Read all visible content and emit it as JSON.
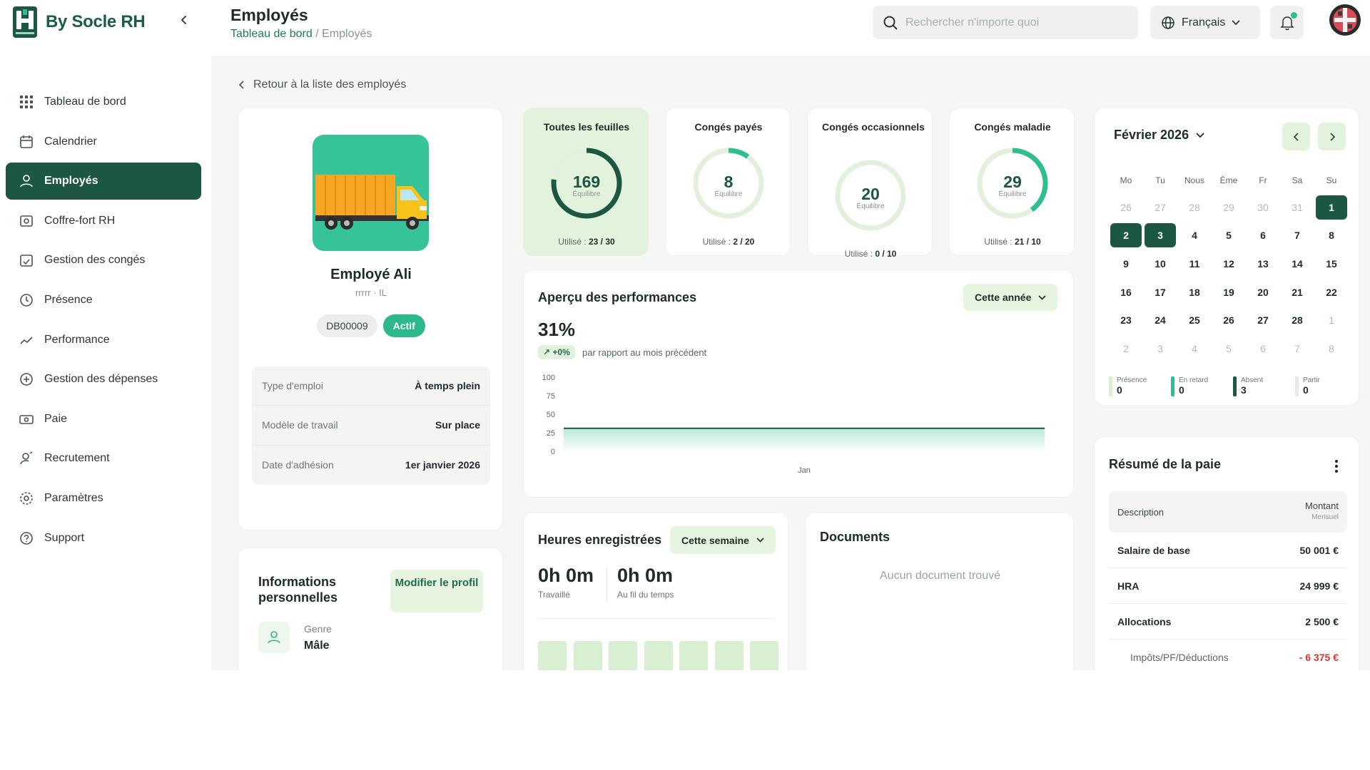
{
  "brand": {
    "name": "By Socle RH"
  },
  "sidebar": {
    "items": [
      {
        "label": "Tableau de bord"
      },
      {
        "label": "Calendrier"
      },
      {
        "label": "Employés"
      },
      {
        "label": "Coffre-fort RH"
      },
      {
        "label": "Gestion des congés"
      },
      {
        "label": "Présence"
      },
      {
        "label": "Performance"
      },
      {
        "label": "Gestion des dépenses"
      },
      {
        "label": "Paie"
      },
      {
        "label": "Recrutement"
      },
      {
        "label": "Paramètres"
      },
      {
        "label": "Support"
      }
    ],
    "active_index": 2
  },
  "header": {
    "title": "Employés",
    "breadcrumb_link": "Tableau de bord",
    "breadcrumb_separator": "/",
    "breadcrumb_current": "Employés",
    "search_placeholder": "Rechercher n'importe quoi",
    "language": "Français"
  },
  "back_link": "Retour à la liste des employés",
  "profile": {
    "name": "Employé Ali",
    "subtitle": "rrrrr · IL",
    "employee_id": "DB00009",
    "status": "Actif",
    "details": [
      {
        "label": "Type d'emploi",
        "value": "À temps plein"
      },
      {
        "label": "Modèle de travail",
        "value": "Sur place"
      },
      {
        "label": "Date d'adhésion",
        "value": "1er janvier 2026"
      }
    ]
  },
  "personal": {
    "title": "Informations personnelles",
    "edit_button": "Modifier le profil",
    "gender_label": "Genre",
    "gender_value": "Mâle"
  },
  "leave_cards": [
    {
      "title": "Toutes les feuilles",
      "value": "169",
      "sub": "Équilibre",
      "used_prefix": "Utilisé :",
      "used": "23 / 30",
      "fraction": 0.767
    },
    {
      "title": "Congés payés",
      "value": "8",
      "sub": "Équilibre",
      "used_prefix": "Utilisé :",
      "used": "2 / 20",
      "fraction": 0.1
    },
    {
      "title": "Congés occasionnels",
      "value": "20",
      "sub": "Équilibre",
      "used_prefix": "Utilisé :",
      "used": "0 / 10",
      "fraction": 0.0
    },
    {
      "title": "Congés maladie",
      "value": "29",
      "sub": "Équilibre",
      "used_prefix": "Utilisé :",
      "used": "21 / 10",
      "fraction": 0.4
    }
  ],
  "performance": {
    "title": "Aperçu des performances",
    "period": "Cette année",
    "percent": "31%",
    "change": "+0%",
    "comparison": "par rapport au mois précédent"
  },
  "chart_data": {
    "type": "area",
    "categories": [
      "Jan"
    ],
    "series": [
      {
        "values": [
          31
        ]
      }
    ],
    "yticks": [
      "100",
      "75",
      "50",
      "25",
      "0"
    ],
    "ylim": [
      0,
      100
    ],
    "grid": false
  },
  "hours": {
    "title": "Heures enregistrées",
    "period": "Cette semaine",
    "worked_value": "0h 0m",
    "worked_label": "Travaillé",
    "overtime_value": "0h 0m",
    "overtime_label": "Au fil du temps"
  },
  "documents": {
    "title": "Documents",
    "empty": "Aucun document trouvé"
  },
  "calendar": {
    "month": "Février 2026",
    "weekdays": [
      "Mo",
      "Tu",
      "Nous",
      "Ème",
      "Fr",
      "Sa",
      "Su"
    ],
    "days": [
      {
        "d": "26",
        "m": true
      },
      {
        "d": "27",
        "m": true
      },
      {
        "d": "28",
        "m": true
      },
      {
        "d": "29",
        "m": true
      },
      {
        "d": "30",
        "m": true
      },
      {
        "d": "31",
        "m": true
      },
      {
        "d": "1",
        "s": true
      },
      {
        "d": "2",
        "s": true
      },
      {
        "d": "3",
        "s": true
      },
      {
        "d": "4"
      },
      {
        "d": "5"
      },
      {
        "d": "6"
      },
      {
        "d": "7"
      },
      {
        "d": "8"
      },
      {
        "d": "9"
      },
      {
        "d": "10"
      },
      {
        "d": "11"
      },
      {
        "d": "12"
      },
      {
        "d": "13"
      },
      {
        "d": "14"
      },
      {
        "d": "15"
      },
      {
        "d": "16"
      },
      {
        "d": "17"
      },
      {
        "d": "18"
      },
      {
        "d": "19"
      },
      {
        "d": "20"
      },
      {
        "d": "21"
      },
      {
        "d": "22"
      },
      {
        "d": "23"
      },
      {
        "d": "24"
      },
      {
        "d": "25"
      },
      {
        "d": "26"
      },
      {
        "d": "27"
      },
      {
        "d": "28"
      },
      {
        "d": "1",
        "m": true
      },
      {
        "d": "2",
        "m": true
      },
      {
        "d": "3",
        "m": true
      },
      {
        "d": "4",
        "m": true
      },
      {
        "d": "5",
        "m": true
      },
      {
        "d": "6",
        "m": true
      },
      {
        "d": "7",
        "m": true
      },
      {
        "d": "8",
        "m": true
      }
    ],
    "legend": [
      {
        "label": "Présence",
        "value": "0",
        "color": "#d7f0cf"
      },
      {
        "label": "En retard",
        "value": "0",
        "color": "#2fbf8f"
      },
      {
        "label": "Absent",
        "value": "3",
        "color": "#1c5744"
      },
      {
        "label": "Partir",
        "value": "0",
        "color": "#e6ebe6"
      }
    ]
  },
  "payroll": {
    "title": "Résumé de la paie",
    "col_description": "Description",
    "col_amount": "Montant",
    "col_amount_sub": "Mensuel",
    "rows": [
      {
        "label": "Salaire de base",
        "value": "50 001 €"
      },
      {
        "label": "HRA",
        "value": "24 999 €"
      },
      {
        "label": "Allocations",
        "value": "2 500 €"
      },
      {
        "label": "Impôts/PF/Déductions",
        "value": "- 6 375 €"
      }
    ]
  },
  "colors": {
    "primary": "#1c5744",
    "accent": "#2fbf8f",
    "light": "#e3f2dd",
    "deduction": "#e0332e"
  }
}
